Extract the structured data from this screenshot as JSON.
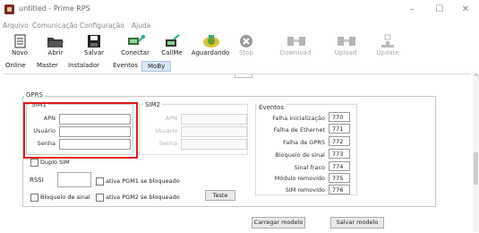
{
  "window": {
    "title": "untitled - Prime RPS",
    "minimize": "–",
    "maximize": "☐",
    "close": "✕"
  },
  "menu": [
    "Arquivo",
    "Comunicação",
    "Configuração",
    "Ajuda"
  ],
  "toolbar": {
    "novo": "Novo",
    "abrir": "Abrir",
    "salvar": "Salvar",
    "conectar": "Conectar",
    "callme": "CallMe",
    "aguardando": "Aguardando",
    "stop": "Stop",
    "download": "Download",
    "upload": "Upload",
    "update": "Update"
  },
  "tabs": [
    "Online",
    "Master",
    "Instalador",
    "Eventos",
    "MoBy"
  ],
  "gprs": {
    "title": "GPRS",
    "sim1": {
      "title": "SIM1",
      "apn": "APN",
      "usuario": "Usuário",
      "senha": "Senha",
      "apn_value": "",
      "usuario_value": "",
      "senha_value": ""
    },
    "sim2": {
      "title": "SIM2",
      "apn": "APN",
      "usuario": "Usuário",
      "senha": "Senha"
    },
    "duplo_sim": "Duplo SIM",
    "rssi": "RSSI",
    "bloqueio_sinal": "Bloqueio de sinal",
    "ativa_pgm1": "ativa PGM1 se bloqueado",
    "ativa_pgm2": "ativa PGM2 se bloqueado",
    "teste": "Teste"
  },
  "eventos": {
    "title": "Eventos",
    "items": [
      {
        "label": "Falha inicialização",
        "value": "770"
      },
      {
        "label": "Falha de Ethernet",
        "value": "771"
      },
      {
        "label": "Falha de GPRS",
        "value": "772"
      },
      {
        "label": "Bloqueio de sinal",
        "value": "773"
      },
      {
        "label": "Sinal fraco",
        "value": "774"
      },
      {
        "label": "Módulo removido",
        "value": "775"
      },
      {
        "label": "SIM removido",
        "value": "776"
      }
    ]
  },
  "buttons": {
    "carregar": "Carregar modelo",
    "salvar_modelo": "Salvar modelo"
  }
}
